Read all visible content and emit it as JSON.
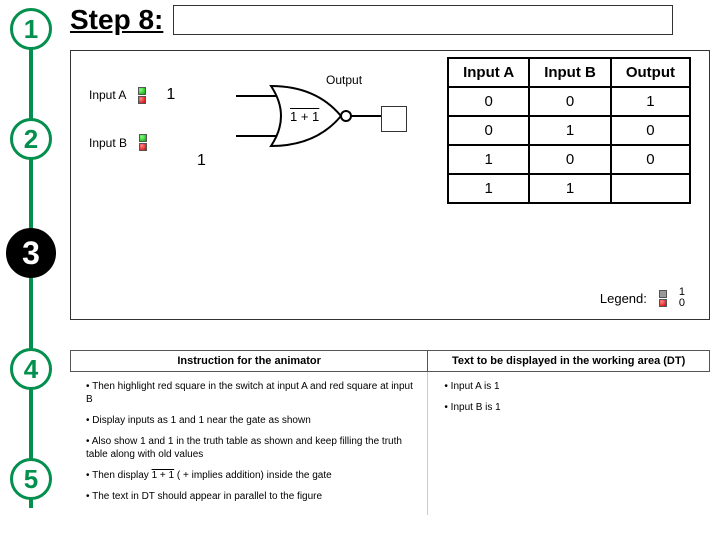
{
  "step_title": "Step 8:",
  "steps": [
    "1",
    "2",
    "3",
    "4",
    "5"
  ],
  "active_step": 3,
  "inputs": {
    "a_label": "Input A",
    "b_label": "Input B",
    "a_val": "1",
    "b_val": "1"
  },
  "gate": {
    "expr": "1 + 1",
    "output_label": "Output"
  },
  "truth_table": {
    "headers": [
      "Input A",
      "Input B",
      "Output"
    ],
    "rows": [
      [
        "0",
        "0",
        "1"
      ],
      [
        "0",
        "1",
        "0"
      ],
      [
        "1",
        "0",
        "0"
      ],
      [
        "1",
        "1",
        ""
      ]
    ]
  },
  "legend": {
    "label": "Legend:",
    "hi": "1",
    "lo": "0"
  },
  "instructions": {
    "left_title": "Instruction for the animator",
    "right_title": "Text to be displayed in the working area (DT)",
    "left_items": [
      "Then highlight red square in the switch  at input A and red square at input B",
      "Display inputs as 1 and 1 near the gate as shown",
      "Also show 1 and 1 in the truth table as shown and keep filling the truth table along with old values",
      "Then display 1 + 1 ( + implies addition) inside the gate",
      "The text in DT should appear in parallel to the figure"
    ],
    "right_items": [
      "Input A is 1",
      "Input B is 1"
    ]
  },
  "chart_data": {
    "type": "table",
    "title": "NOR gate truth table (Step 8)",
    "columns": [
      "Input A",
      "Input B",
      "Output"
    ],
    "rows": [
      [
        0,
        0,
        1
      ],
      [
        0,
        1,
        0
      ],
      [
        1,
        0,
        0
      ],
      [
        1,
        1,
        null
      ]
    ],
    "gate": "NOR",
    "inputs_current": {
      "A": 1,
      "B": 1
    }
  }
}
